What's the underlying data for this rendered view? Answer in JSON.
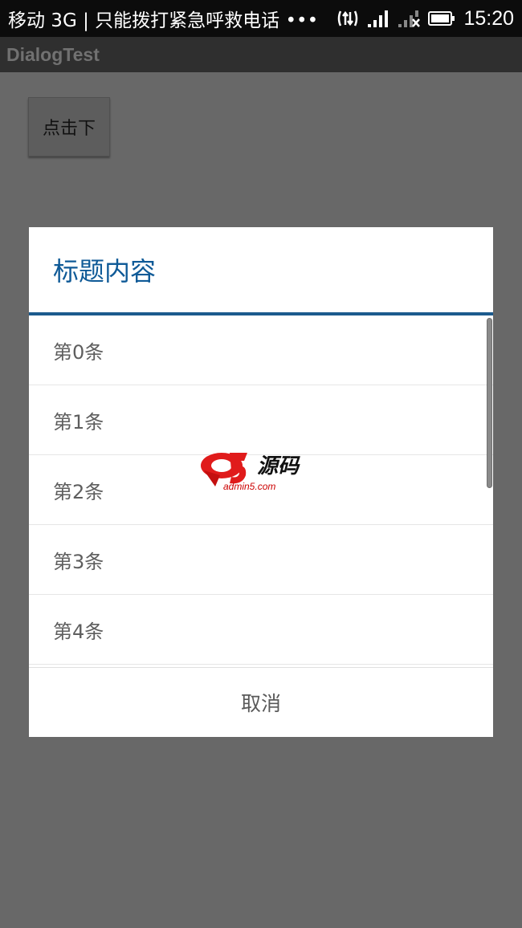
{
  "status_bar": {
    "carrier_text": "移动 3G | 只能拨打紧急呼救电话 •••",
    "time": "15:20",
    "icons": [
      "data-transfer-icon",
      "signal-icon",
      "signal-no-sim-icon",
      "battery-icon"
    ]
  },
  "action_bar": {
    "title": "DialogTest"
  },
  "content": {
    "button_label": "点击下"
  },
  "dialog": {
    "title": "标题内容",
    "items": [
      {
        "label": "第0条"
      },
      {
        "label": "第1条"
      },
      {
        "label": "第2条"
      },
      {
        "label": "第3条"
      },
      {
        "label": "第4条"
      }
    ],
    "cancel_label": "取消",
    "accent_color": "#1c5b8e"
  },
  "watermark": {
    "logo": "a5",
    "text": "源码",
    "url": "admin5.com"
  }
}
